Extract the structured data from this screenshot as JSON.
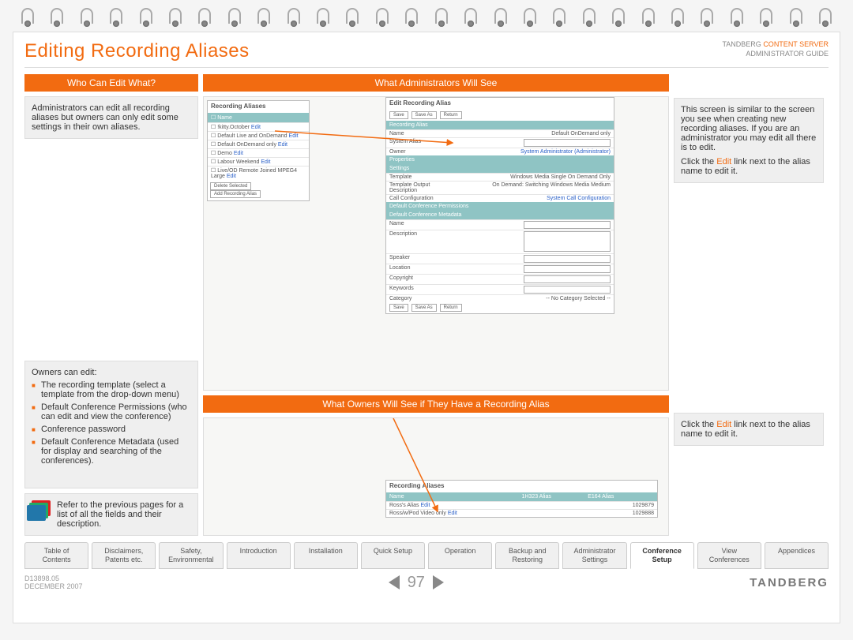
{
  "brand": {
    "top_l": "TANDBERG",
    "top_o": "CONTENT SERVER",
    "top_sub": "ADMINISTRATOR GUIDE",
    "footer": "TANDBERG"
  },
  "page": {
    "title": "Editing Recording Aliases",
    "number": "97",
    "doc_id": "D13898.05",
    "date": "DECEMBER 2007"
  },
  "left": {
    "header": "Who Can Edit What?",
    "p1": "Administrators can edit all recording aliases but owners can only edit some settings in their own aliases.",
    "owners_intro": "Owners can edit:",
    "bullets": [
      "The recording template (select a template from the drop-down menu)",
      "Default Conference Permissions (who can edit and view the conference)",
      "Conference password",
      "Default Conference Metadata (used for display and searching of the conferences)."
    ],
    "note": "Refer to the previous pages for a list of all the fields and their description."
  },
  "mid": {
    "header1": "What Administrators Will See",
    "header2": "What Owners Will See if They Have a Recording Alias",
    "shot1": {
      "list_title": "Recording Aliases",
      "th_name": "Name",
      "items": [
        "!kitty.October",
        "Default Live and OnDemand",
        "Default OnDemand only",
        "Demo",
        "Labour Weekend",
        "Live/OD Remote Joined MPEG4 Large"
      ],
      "edit": "Edit",
      "btn_del": "Delete Selected",
      "btn_add": "Add Recording Alias",
      "edit_title": "Edit Recording Alias",
      "btn_save": "Save",
      "btn_saveas": "Save As",
      "btn_return": "Return",
      "sec_ra": "Recording Alias",
      "f_name": "Name",
      "v_name": "Default OnDemand only",
      "f_sys": "System Alias",
      "v_sys": "",
      "f_owner": "Owner",
      "v_owner": "System Administrator (Administrator)",
      "sec_prop": "Properties",
      "sec_set": "Settings",
      "f_tpl": "Template",
      "v_tpl": "Windows Media Single On Demand Only",
      "f_tod": "Template Output Description",
      "v_tod": "On Demand: Switching Windows Media Medium",
      "f_cc": "Call Configuration",
      "v_cc": "System Call Configuration",
      "sec_dcp": "Default Conference Permissions",
      "sec_dcm": "Default Conference Metadata",
      "f_mname": "Name",
      "f_desc": "Description",
      "f_spk": "Speaker",
      "f_loc": "Location",
      "f_cpy": "Copyright",
      "f_kw": "Keywords",
      "f_cat": "Category",
      "v_cat": "-- No Category Selected --"
    },
    "shot2": {
      "list_title": "Recording Aliases",
      "th_name": "Name",
      "th_h323": "1H323 Alias",
      "th_e164": "E164 Alias",
      "r1": "Ross's Alias",
      "r1e": "Edit",
      "r1v": "1029879",
      "r2": "Ross/w/Pod Video only",
      "r2e": "Edit",
      "r2v": "1029888"
    }
  },
  "right": {
    "p1a": "This screen is similar to the screen you see when creating new recording aliases. If you are an administrator you may edit all there is to edit.",
    "p1b_pre": "Click the ",
    "p1b_edit": "Edit",
    "p1b_post": " link next to the alias name to edit it.",
    "p2_pre": "Click the ",
    "p2_edit": "Edit",
    "p2_post": " link next to the alias name to edit it."
  },
  "tabs": [
    "Table of\nContents",
    "Disclaimers,\nPatents etc.",
    "Safety,\nEnvironmental",
    "Introduction",
    "Installation",
    "Quick Setup",
    "Operation",
    "Backup and\nRestoring",
    "Administrator\nSettings",
    "Conference\nSetup",
    "View\nConferences",
    "Appendices"
  ],
  "active_tab": 9
}
